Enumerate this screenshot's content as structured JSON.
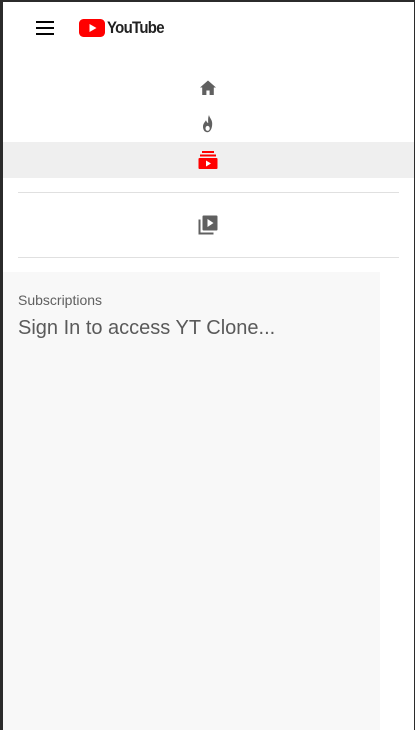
{
  "header": {
    "logo_text": "YouTube",
    "menu_icon": "hamburger-menu-icon",
    "logo_icon": "youtube-play-logo-icon"
  },
  "nav": {
    "items": [
      {
        "name": "home",
        "icon": "home-icon",
        "active": false
      },
      {
        "name": "trending",
        "icon": "fire-icon",
        "active": false
      },
      {
        "name": "subscriptions",
        "icon": "subscriptions-icon",
        "active": true
      }
    ],
    "secondary": [
      {
        "name": "library",
        "icon": "video-library-icon",
        "active": false
      }
    ]
  },
  "subscriptions_panel": {
    "heading": "Subscriptions",
    "message": "Sign In to access YT Clone..."
  },
  "colors": {
    "brand_red": "#ff0000",
    "icon_gray": "#606060",
    "active_row_bg": "#efefef",
    "panel_bg": "#f8f8f8"
  }
}
